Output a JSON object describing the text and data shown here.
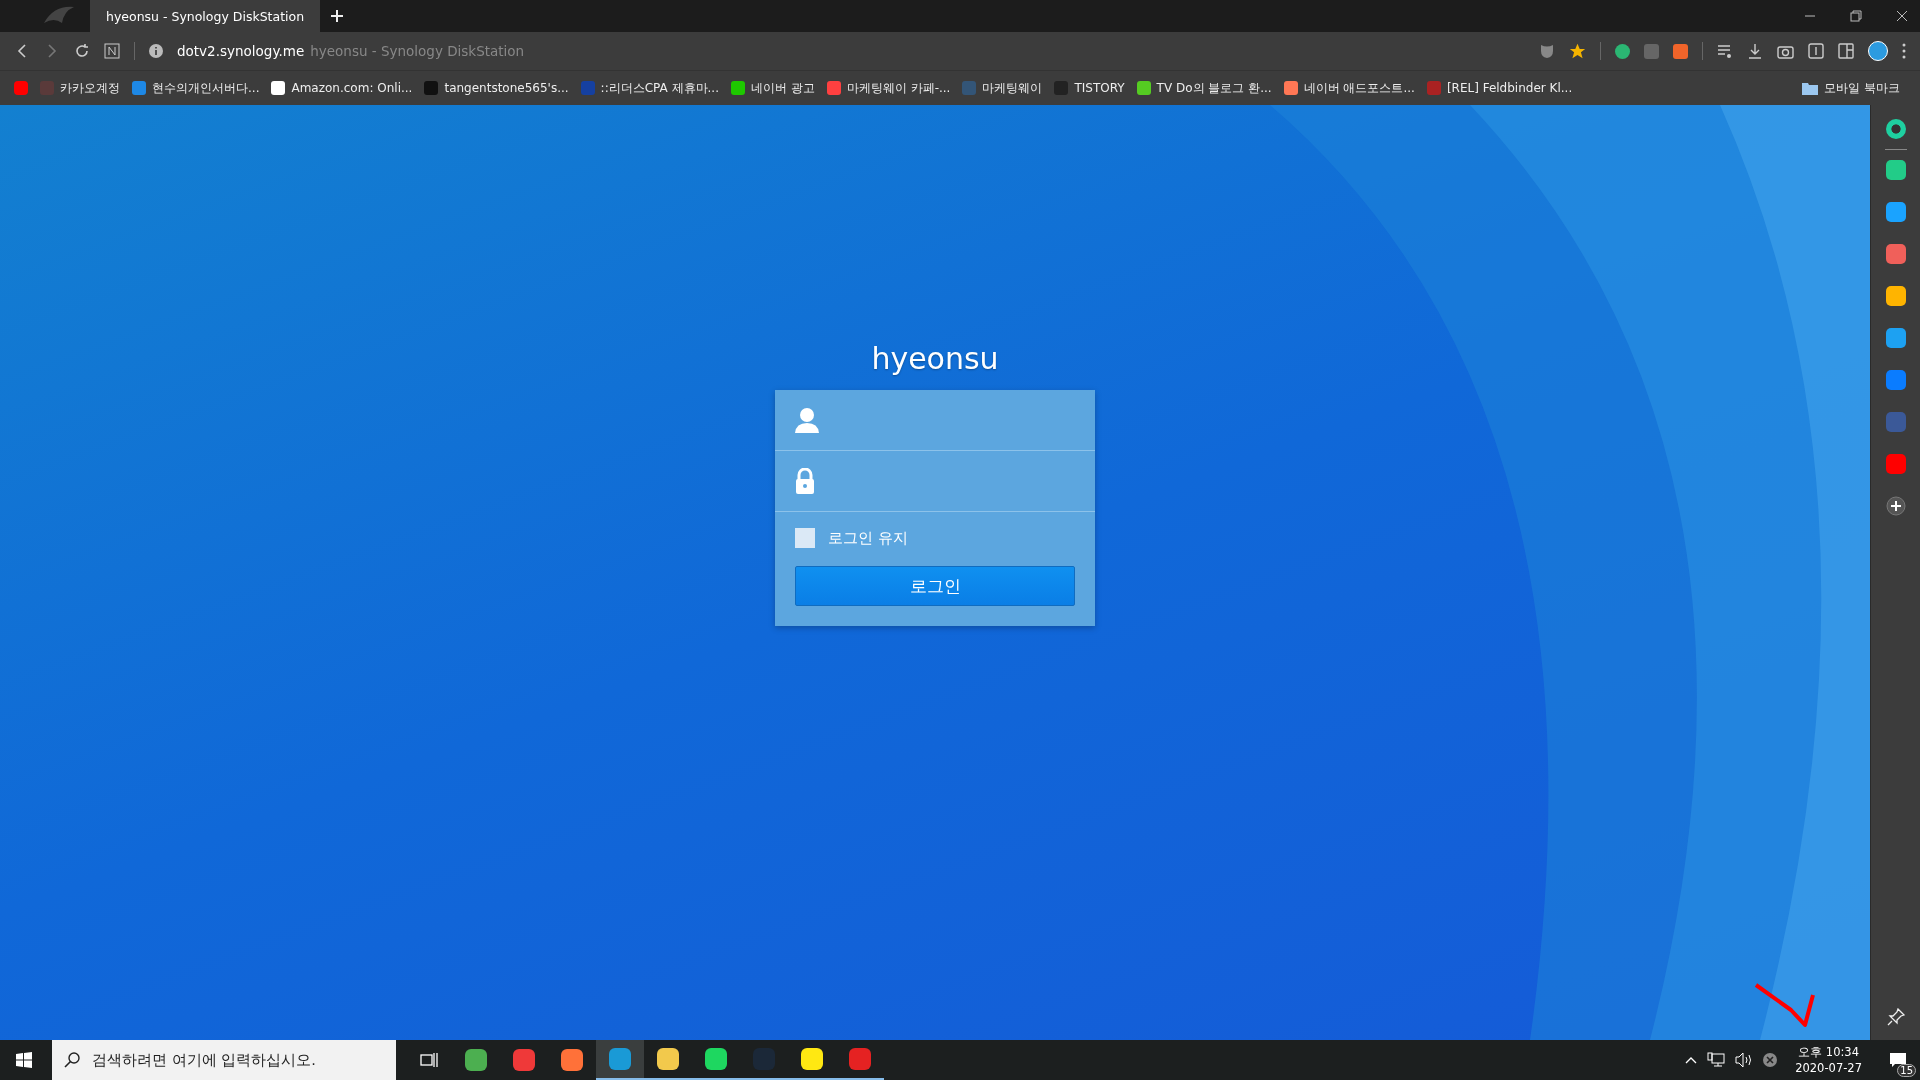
{
  "browser": {
    "tabs": [
      {
        "title": "hyeonsu - Synology DiskStation",
        "selected": true
      }
    ],
    "address": {
      "host": "dotv2.synology.me",
      "page_title": "hyeonsu - Synology DiskStation"
    },
    "bookmarks": [
      {
        "kind": "icon"
      },
      {
        "label": "카카오계정"
      },
      {
        "label": "현수의개인서버다..."
      },
      {
        "label": "Amazon.com: Onli..."
      },
      {
        "label": "tangentstone565's..."
      },
      {
        "label": "::리더스CPA 제휴마..."
      },
      {
        "label": "네이버 광고"
      },
      {
        "label": "마케팅웨이 카페-..."
      },
      {
        "label": "마케팅웨이"
      },
      {
        "label": "TISTORY"
      },
      {
        "label": "TV Do의 블로그 환..."
      },
      {
        "label": "네이버 애드포스트..."
      },
      {
        "label": "[REL] Feldbinder Kl..."
      }
    ],
    "mobile_bookmarks": "모바일 북마크"
  },
  "login": {
    "title": "hyeonsu",
    "remember": {
      "label": "로그인 유지",
      "checked": false
    },
    "button": "로그인"
  },
  "taskbar": {
    "search_placeholder": "검색하려면 여기에 입력하십시오.",
    "apps": [
      {
        "running": false,
        "active": false
      },
      {
        "running": false,
        "active": false
      },
      {
        "running": false,
        "active": false
      },
      {
        "running": true,
        "active": true
      },
      {
        "running": true,
        "active": false
      },
      {
        "running": true,
        "active": false
      },
      {
        "running": true,
        "active": false
      },
      {
        "running": true,
        "active": false
      },
      {
        "running": true,
        "active": false
      }
    ],
    "time": "오후 10:34",
    "date": "2020-07-27",
    "notifications": "15"
  }
}
